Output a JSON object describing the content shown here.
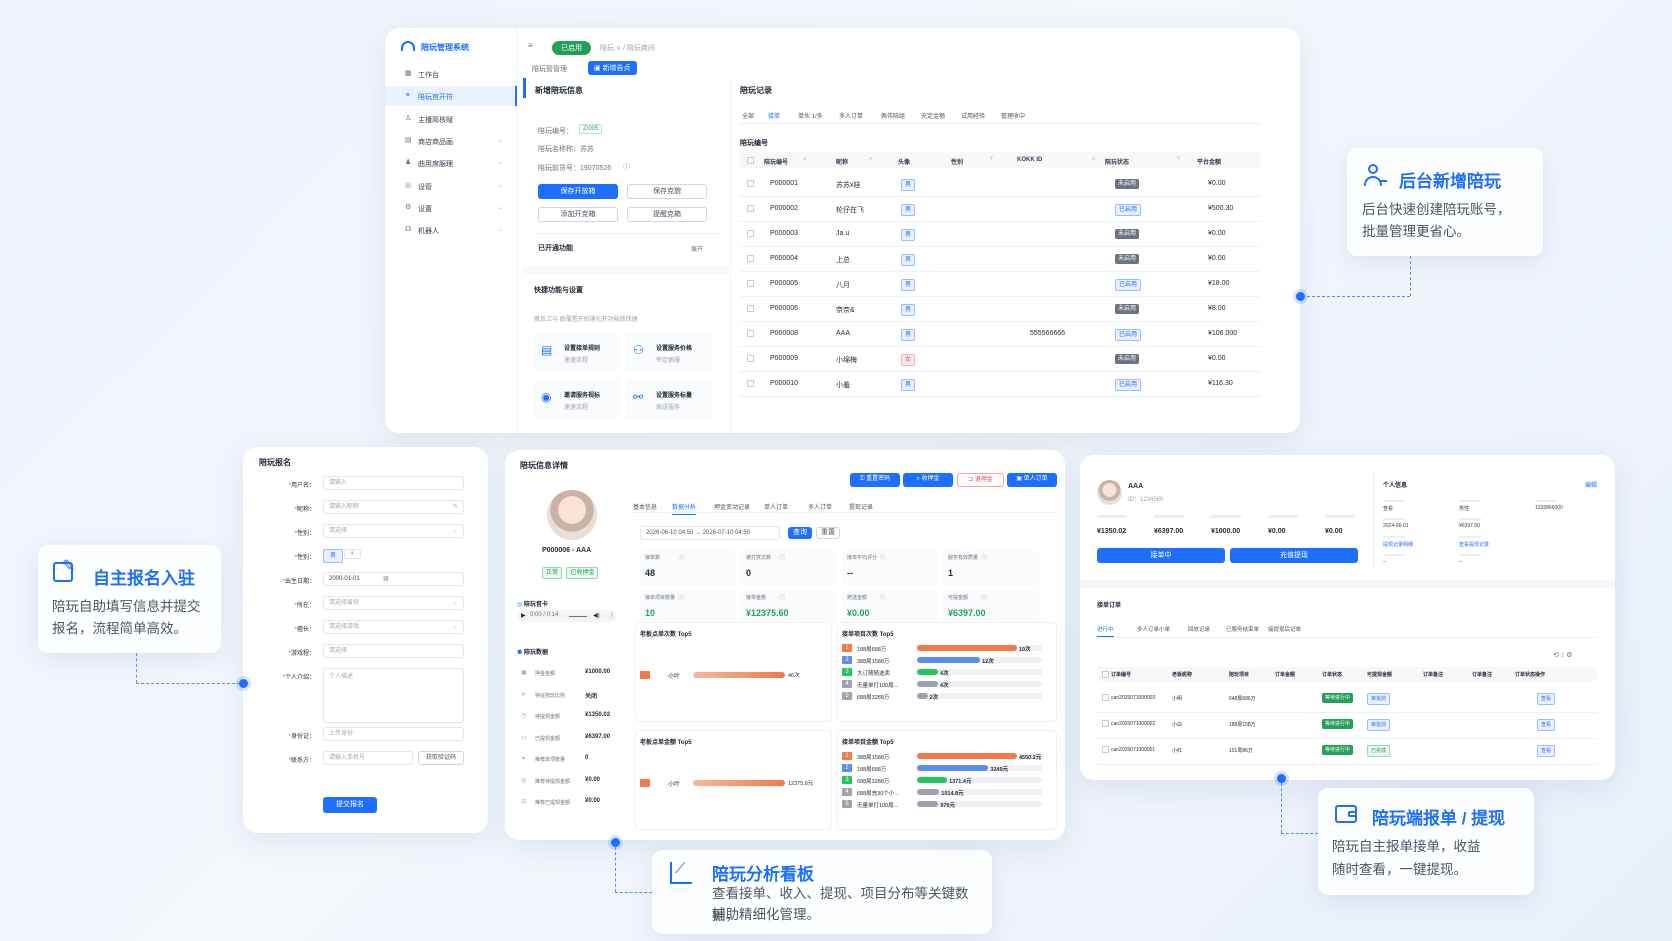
{
  "admin": {
    "logo": "陪玩管理系统",
    "menu": [
      {
        "label": "工作台",
        "icon": "grid-icon"
      },
      {
        "label": "陪玩官开符",
        "icon": "link-icon",
        "active": true
      },
      {
        "label": "主播简核赋",
        "icon": "user-icon"
      },
      {
        "label": "商店商品画",
        "icon": "store-icon",
        "arrow": true
      },
      {
        "label": "曲用席服理",
        "icon": "person-icon",
        "arrow": true
      },
      {
        "label": "设管",
        "icon": "target-icon",
        "arrow": true
      },
      {
        "label": "设置",
        "icon": "gear-icon",
        "arrow": true
      },
      {
        "label": "机器人",
        "icon": "robot-icon",
        "arrow": true
      }
    ],
    "topbar": {
      "badge": "已启用",
      "crumb": "陪玩 ∨ / 陪玩商间"
    },
    "tabs": [
      "陪玩管管理",
      "新增告贞"
    ],
    "left_title": "新增陪玩信息",
    "info": [
      "陪玩编号：",
      "陪玩名称称：苏苏",
      "陪玩前货号：19070526"
    ],
    "info_tag": "Z/005",
    "btns": [
      "保存开放箱",
      "保存克貌",
      "添加开克箱",
      "提醒克箱"
    ],
    "opened": "已开通功能",
    "expand": "展开",
    "quick_title": "快捷功能与设置",
    "quick_desc": "概反工与 疲覆置开拍捕扎开功能做快捷",
    "quick": [
      {
        "t": "设置接单规则",
        "d": "速速流程"
      },
      {
        "t": "设置服务价格",
        "d": "帝定佩服"
      },
      {
        "t": "邀请服务视标",
        "d": "速速流程"
      },
      {
        "t": "设置服务标量",
        "d": "佩送服务"
      }
    ],
    "right_title": "陪玩记录",
    "rtabs": [
      "全部",
      "接单",
      "单伙 1/多",
      "多人订单",
      "佩伟陪组",
      "充定金额",
      "试用经验",
      "管理收中"
    ],
    "sub": "陪玩编号",
    "cols": [
      "陪玩编号",
      "昵称",
      "头像",
      "性别",
      "KOKK ID",
      "陪玩状态",
      "平台金额"
    ],
    "rows": [
      {
        "id": "P000001",
        "name": "苏苏x娃",
        "g": "男",
        "kid": "",
        "st": "未启用",
        "amt": "¥0.00"
      },
      {
        "id": "P000002",
        "name": "轮仔在飞",
        "g": "男",
        "kid": "",
        "st": "已启用",
        "amt": "¥500.30"
      },
      {
        "id": "P000003",
        "name": "Ja.u",
        "g": "男",
        "kid": "",
        "st": "未启用",
        "amt": "¥0.00"
      },
      {
        "id": "P000004",
        "name": "上总",
        "g": "男",
        "kid": "",
        "st": "未启用",
        "amt": "¥0.00"
      },
      {
        "id": "P000005",
        "name": "八月",
        "g": "男",
        "kid": "",
        "st": "已启用",
        "amt": "¥18.00"
      },
      {
        "id": "P000006",
        "name": "奈奈&",
        "g": "男",
        "kid": "",
        "st": "未启用",
        "amt": "¥8.00"
      },
      {
        "id": "P000008",
        "name": "AAA",
        "g": "男",
        "kid": "555566666",
        "st": "已启用",
        "amt": "¥106.000"
      },
      {
        "id": "P000009",
        "name": "小绵梅",
        "g": "女",
        "kid": "",
        "st": "未启用",
        "amt": "¥0.00"
      },
      {
        "id": "P000010",
        "name": "小羞",
        "g": "男",
        "kid": "",
        "st": "已启用",
        "amt": "¥116.30"
      }
    ]
  },
  "signup": {
    "title": "陪玩报名",
    "fields": [
      {
        "label": "用户名：",
        "ph": "请输入"
      },
      {
        "label": "昵称：",
        "ph": "请输入昵称"
      },
      {
        "label": "性别：",
        "ph": "请选择"
      },
      {
        "label": "性别：",
        "ph": ""
      },
      {
        "label": "出生日期：",
        "ph": "2000-01-01"
      },
      {
        "label": "所在：",
        "ph": "请选择省份"
      },
      {
        "label": "擅长：",
        "ph": "请选择游戏"
      },
      {
        "label": "游戏程：",
        "ph": "请选择"
      },
      {
        "label": "个人介绍：",
        "ph": "个人描述"
      },
      {
        "label": "身份证：",
        "ph": "上传身份"
      },
      {
        "label": "联系方：",
        "ph": "请输入手机号"
      }
    ],
    "gender": [
      "男",
      "♀"
    ],
    "code_btn": "获取验证码",
    "submit": "提交报名"
  },
  "detail": {
    "title": "陪玩信息详情",
    "actions": [
      "重置密码",
      "收押金",
      "退押金",
      "单人订单"
    ],
    "name": "P000006 - AAA",
    "tags": [
      "正常",
      "已收押金"
    ],
    "tabs": [
      "基本信息",
      "数据分析",
      "押金变动记录",
      "单人订单",
      "多人订单",
      "提现记录"
    ],
    "date_from": "2026-06-10 04:50",
    "date_to": "2026-07-10 04:50",
    "query": "查询",
    "reset": "重置",
    "stats": [
      {
        "l": "接单数",
        "v": "48"
      },
      {
        "l": "被打赏次数",
        "v": "0"
      },
      {
        "l": "接单平均评分",
        "v": "--"
      },
      {
        "l": "服务有效质量",
        "v": "1"
      },
      {
        "l": "接单项目数量",
        "v": "10"
      },
      {
        "l": "接单金额",
        "v": "¥12375.60"
      },
      {
        "l": "赠送金额",
        "v": "¥0.00"
      },
      {
        "l": "可提金额",
        "v": "¥6397.00"
      }
    ],
    "voice": "陪玩音卡",
    "audio_time": "0:00 / 0:14",
    "data_title": "陪玩数据",
    "data": [
      {
        "l": "押金金额",
        "v": "¥1000.00"
      },
      {
        "l": "特征陪玩比例",
        "v": "关闭"
      },
      {
        "l": "待提现金额",
        "v": "¥1350.02"
      },
      {
        "l": "已提现金额",
        "v": "¥6397.00"
      },
      {
        "l": "推荐单项数量",
        "v": "0"
      },
      {
        "l": "推荐待提现金额",
        "v": "¥0.00"
      },
      {
        "l": "推荐已提现金额",
        "v": "¥0.00"
      }
    ],
    "c1": {
      "title": "老板点单次数 Top5",
      "rows": [
        {
          "n": "小叶",
          "v": 46,
          "lab": "46次"
        }
      ]
    },
    "c2": {
      "title": "接单项目次数 Top5",
      "rows": [
        {
          "n": "188局688万",
          "v": 19,
          "lab": "19次"
        },
        {
          "n": "388局1588万",
          "v": 12,
          "lab": "12次"
        },
        {
          "n": "大订随随选卖",
          "v": 4,
          "lab": "4次"
        },
        {
          "n": "无量单打100局...",
          "v": 4,
          "lab": "4次"
        },
        {
          "n": "688局3288万",
          "v": 2,
          "lab": "2次"
        }
      ]
    },
    "c3": {
      "title": "老板点单金额 Top5",
      "rows": [
        {
          "n": "小叶",
          "v": 12375.6,
          "lab": "12375.6元"
        }
      ]
    },
    "c4": {
      "title": "接单项目金额 Top5",
      "rows": [
        {
          "n": "388局1588万",
          "v": 4550.2,
          "lab": "4550.2元"
        },
        {
          "n": "188局688万",
          "v": 3249,
          "lab": "3249元"
        },
        {
          "n": "688局3288万",
          "v": 1371.4,
          "lab": "1371.4元"
        },
        {
          "n": "688局充30个小...",
          "v": 1014.8,
          "lab": "1014.8元"
        },
        {
          "n": "无量单打100局...",
          "v": 970,
          "lab": "970元"
        }
      ]
    }
  },
  "player": {
    "name": "AAA",
    "uid": "ID：1234560",
    "vals": [
      "¥1350.02",
      "¥6397.00",
      "¥1000.00",
      "¥0.00",
      "¥0.00"
    ],
    "btns": [
      "接单中",
      "充值提现"
    ],
    "pi": "个人信息",
    "edit": "编辑",
    "pi_rows": [
      [
        "查看",
        "男性",
        "1326866000"
      ],
      [
        "2024-06-01",
        "¥6397.00"
      ],
      [
        "提现记录明细",
        "查看提现记录"
      ],
      [
        "--",
        "--"
      ]
    ],
    "ot": "接单订单",
    "otabs": [
      "进行中",
      "多人订单小单",
      "回放记录",
      "已服务结束单",
      "接提现后记单"
    ],
    "cols": [
      "订单编号",
      "老板昵称",
      "陪玩项目",
      "订单金额",
      "订单状态",
      "可提现金额",
      "订单备注",
      "订单备注",
      "订单状态操作"
    ],
    "orders": [
      {
        "no": "can2025071000003",
        "b": "小明",
        "p": "648局686万",
        "s": "等待进行中",
        "st": "审批前",
        "op": "查看"
      },
      {
        "no": "can2025071000002",
        "b": "小白",
        "p": "188局158万",
        "s": "等待进行中",
        "st": "审批前",
        "op": "查看"
      },
      {
        "no": "can2025071000001",
        "b": "小红",
        "p": "101局86万",
        "s": "等待进行中",
        "st": "已完成",
        "op": "查看"
      }
    ]
  },
  "callouts": {
    "c1": {
      "title": "后台新增陪玩",
      "desc1": "后台快速创建陪玩账号，",
      "desc2": "批量管理更省心。"
    },
    "c2": {
      "title": "自主报名入驻",
      "desc1": "陪玩自助填写信息并提交",
      "desc2": "报名，流程简单高效。"
    },
    "c3": {
      "title": "陪玩分析看板",
      "desc1": "查看接单、收入、提现、项目分布等关键数据，",
      "desc2": "辅助精细化管理。"
    },
    "c4": {
      "title": "陪玩端报单 / 提现",
      "desc1": "陪玩自主报单接单，收益",
      "desc2": "随时查看，一键提现。"
    }
  },
  "colors": {
    "accent": "#1e6fff",
    "orange": "#f07a4a",
    "green": "#22a05a"
  }
}
